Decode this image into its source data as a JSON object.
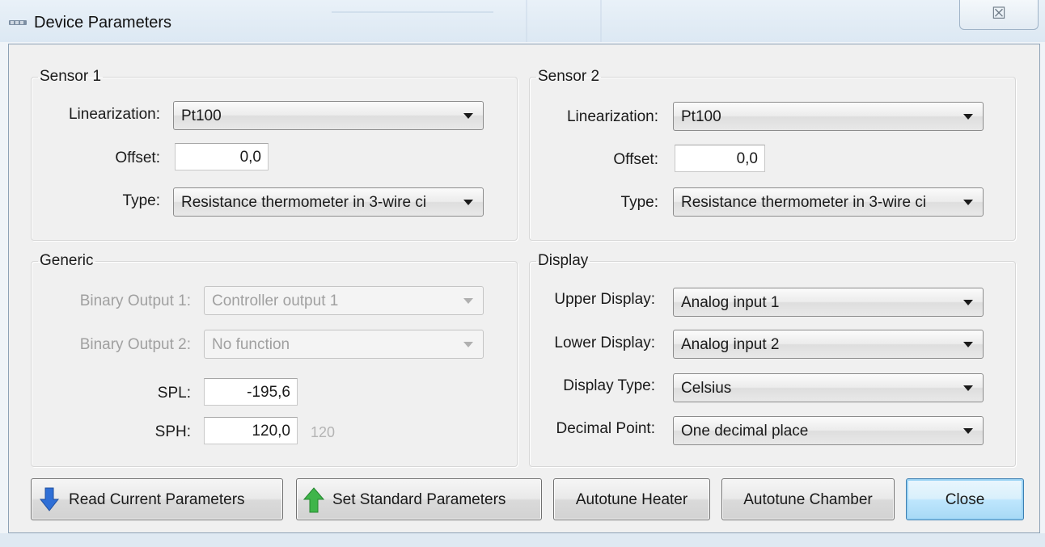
{
  "window": {
    "title": "Device Parameters",
    "close_glyph": "☒"
  },
  "sensor1": {
    "legend": "Sensor 1",
    "linearization_label": "Linearization:",
    "linearization_value": "Pt100",
    "offset_label": "Offset:",
    "offset_value": "0,0",
    "type_label": "Type:",
    "type_value": "Resistance thermometer in 3-wire ci"
  },
  "sensor2": {
    "legend": "Sensor 2",
    "linearization_label": "Linearization:",
    "linearization_value": "Pt100",
    "offset_label": "Offset:",
    "offset_value": "0,0",
    "type_label": "Type:",
    "type_value": "Resistance thermometer in 3-wire ci"
  },
  "generic": {
    "legend": "Generic",
    "binary1_label": "Binary Output 1:",
    "binary1_value": "Controller output 1",
    "binary2_label": "Binary Output 2:",
    "binary2_value": "No function",
    "spl_label": "SPL:",
    "spl_value": "-195,6",
    "sph_label": "SPH:",
    "sph_value": "120,0",
    "sph_hint": "120"
  },
  "display": {
    "legend": "Display",
    "upper_label": "Upper Display:",
    "upper_value": "Analog input 1",
    "lower_label": "Lower Display:",
    "lower_value": "Analog input 2",
    "type_label": "Display Type:",
    "type_value": "Celsius",
    "decimal_label": "Decimal Point:",
    "decimal_value": "One decimal place"
  },
  "buttons": {
    "read": "Read Current Parameters",
    "set_standard": "Set Standard Parameters",
    "autotune_heater": "Autotune Heater",
    "autotune_chamber": "Autotune Chamber",
    "close": "Close"
  },
  "icons": {
    "app": "device-icon",
    "read": "arrow-down-icon",
    "set_standard": "arrow-up-icon",
    "combo": "chevron-down-icon"
  },
  "colors": {
    "read_arrow": "#2f6fd6",
    "set_arrow": "#3fb54a",
    "close_highlight": "#9cd4f5"
  }
}
